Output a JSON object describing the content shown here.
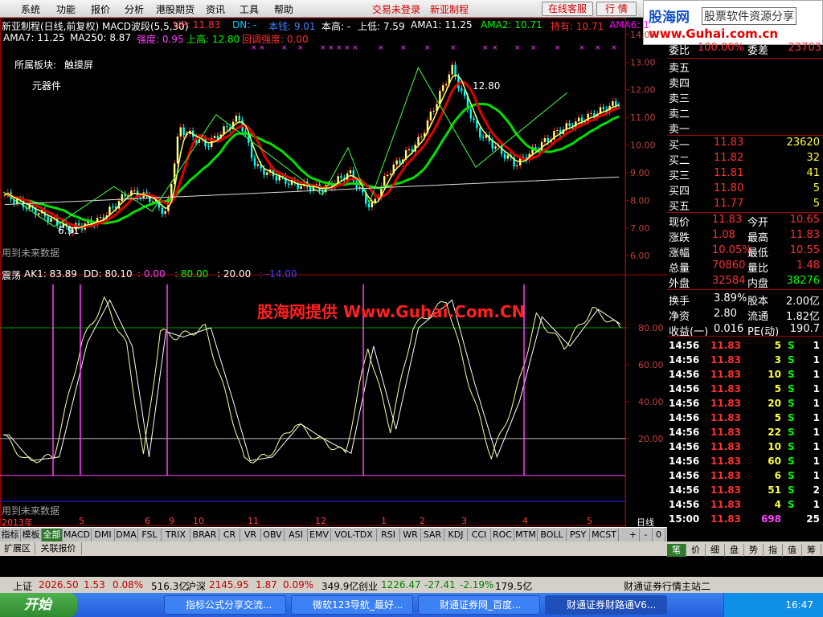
{
  "menu": {
    "items": [
      "系统",
      "功能",
      "报价",
      "分析",
      "港股期货",
      "资讯",
      "工具",
      "帮助"
    ],
    "trade_not_logged": "交易未登录",
    "stock_name": "新亚制程",
    "online_service": "在线客服",
    "market": "行 情"
  },
  "logo": {
    "l1": "股海网",
    "l2": "股票软件资源分享",
    "l3": "www.Guhai.com.cn"
  },
  "main_chart": {
    "title": "新亚制程(日线,前复权) MACD波段(5,5,30)",
    "ind1": [
      {
        "t": "UP: 11.83",
        "c": "#ff3030"
      },
      {
        "t": "DN: -",
        "c": "#00c8ff"
      },
      {
        "t": "本钱: 9.01",
        "c": "#4080ff"
      },
      {
        "t": "本高: -",
        "c": "#ffffff"
      },
      {
        "t": "上低: 7.59",
        "c": "#ffffff"
      },
      {
        "t": "AMA1: 11.25",
        "c": "#ffffff"
      },
      {
        "t": "AMA2: 10.71",
        "c": "#00ff00"
      },
      {
        "t": "持有: 10.71",
        "c": "#ff3030"
      },
      {
        "t": "AMA6: 1",
        "c": "#ff00ff"
      }
    ],
    "ind2": [
      {
        "t": "AMA7: 11.25",
        "c": "#ffffff"
      },
      {
        "t": "MA250: 8.87",
        "c": "#ffffff"
      },
      {
        "t": "强度: 0.95",
        "c": "#ff40ff"
      },
      {
        "t": "上高: 12.80",
        "c": "#00ff00"
      },
      {
        "t": "回调强度: 0.00",
        "c": "#ff3030"
      }
    ],
    "sector_label": "所属板块:",
    "sector1": "触摸屏",
    "sector2": "元器件",
    "peak_label": "12.80",
    "low_label": "6.91",
    "future1": "用到未来数据",
    "yticks": [
      "14.00",
      "13.00",
      "12.00",
      "11.00",
      "10.00",
      "9.00",
      "8.00",
      "7.00",
      "6.00"
    ]
  },
  "osc_chart": {
    "title": "震荡",
    "ind": [
      {
        "t": "AK1: 83.89",
        "c": "#ffffff"
      },
      {
        "t": "DD: 80.10",
        "c": "#ffffff"
      },
      {
        "t": ": 0.00",
        "c": "#ff40ff"
      },
      {
        "t": ": 80.00",
        "c": "#00ff00"
      },
      {
        "t": ": 20.00",
        "c": "#ffffff"
      },
      {
        "t": ": -14.00",
        "c": "#4040ff"
      }
    ],
    "yticks": [
      "80.00",
      "60.00",
      "40.00",
      "20.00"
    ],
    "future": "用到未来数据",
    "watermark": "股海网提供 Www.Guhai.Com.CN"
  },
  "xaxis": {
    "labels": [
      "2013年",
      "5",
      "6",
      "9",
      "10",
      "11",
      "12",
      "1",
      "2",
      "3",
      "4",
      "5"
    ],
    "period": "日线"
  },
  "indicator_tabs": [
    "指标",
    "模板",
    "全部",
    "MACD",
    "DMI",
    "DMA",
    "FSL",
    "TRIX",
    "BRAR",
    "CR",
    "VR",
    "OBV",
    "ASI",
    "EMV",
    "VOL-TDX",
    "RSI",
    "WR",
    "SAR",
    "KDJ",
    "CCI",
    "ROC",
    "MTM",
    "BOLL",
    "PSY",
    "MCST"
  ],
  "tab_controls": [
    "+",
    "-",
    "0"
  ],
  "sub_tabs": [
    "扩展区",
    "关联报价"
  ],
  "quote": {
    "wei": {
      "l1": "委比",
      "v1": "100.00%",
      "l2": "委差",
      "v2": "23703"
    },
    "sells": [
      "卖五",
      "卖四",
      "卖三",
      "卖二",
      "卖一"
    ],
    "buys": [
      {
        "n": "买一",
        "p": "11.83",
        "v": "23620"
      },
      {
        "n": "买二",
        "p": "11.82",
        "v": "32"
      },
      {
        "n": "买三",
        "p": "11.81",
        "v": "41"
      },
      {
        "n": "买四",
        "p": "11.80",
        "v": "5"
      },
      {
        "n": "买五",
        "p": "11.77",
        "v": "5"
      }
    ],
    "stats": [
      {
        "a": "现价",
        "av": "11.83",
        "b": "今开",
        "bv": "10.65"
      },
      {
        "a": "涨跌",
        "av": "1.08",
        "b": "最高",
        "bv": "11.83"
      },
      {
        "a": "涨幅",
        "av": "10.05%",
        "b": "最低",
        "bv": "10.55"
      },
      {
        "a": "总量",
        "av": "70860",
        "b": "量比",
        "bv": "1.48"
      },
      {
        "a": "外盘",
        "av": "32584",
        "b": "内盘",
        "bv": "38276"
      }
    ],
    "fund": [
      {
        "a": "换手",
        "av": "3.89%",
        "b": "股本",
        "bv": "2.00亿"
      },
      {
        "a": "净资",
        "av": "2.80",
        "b": "流通",
        "bv": "1.82亿"
      },
      {
        "a": "收益(一)",
        "av": "0.016",
        "b": "PE(动)",
        "bv": "190.7"
      }
    ]
  },
  "ticks": [
    {
      "t": "14:56",
      "p": "11.83",
      "v": "5",
      "s": "S",
      "n": "1"
    },
    {
      "t": "14:56",
      "p": "11.83",
      "v": "3",
      "s": "S",
      "n": "1"
    },
    {
      "t": "14:56",
      "p": "11.83",
      "v": "10",
      "s": "S",
      "n": "1"
    },
    {
      "t": "14:56",
      "p": "11.83",
      "v": "5",
      "s": "S",
      "n": "1"
    },
    {
      "t": "14:56",
      "p": "11.83",
      "v": "20",
      "s": "S",
      "n": "1"
    },
    {
      "t": "14:56",
      "p": "11.83",
      "v": "5",
      "s": "S",
      "n": "1"
    },
    {
      "t": "14:56",
      "p": "11.83",
      "v": "22",
      "s": "S",
      "n": "1"
    },
    {
      "t": "14:56",
      "p": "11.83",
      "v": "10",
      "s": "S",
      "n": "1"
    },
    {
      "t": "14:56",
      "p": "11.83",
      "v": "60",
      "s": "S",
      "n": "1"
    },
    {
      "t": "14:56",
      "p": "11.83",
      "v": "6",
      "s": "S",
      "n": "1"
    },
    {
      "t": "14:56",
      "p": "11.83",
      "v": "51",
      "s": "S",
      "n": "2"
    },
    {
      "t": "14:56",
      "p": "11.83",
      "v": "4",
      "s": "S",
      "n": "1"
    },
    {
      "t": "15:00",
      "p": "11.83",
      "v": "698",
      "s": "",
      "n": "25"
    }
  ],
  "right_tabs": [
    "笔",
    "价",
    "细",
    "盘",
    "势",
    "指",
    "值",
    "筹"
  ],
  "status": [
    {
      "t": "上证",
      "c": "#000000"
    },
    {
      "t": "2026.50",
      "c": "#c00000"
    },
    {
      "t": "1.53",
      "c": "#c00000"
    },
    {
      "t": "0.08%",
      "c": "#c00000"
    },
    {
      "t": "516.3亿",
      "c": "#000000"
    },
    {
      "t": "沪深",
      "c": "#000000"
    },
    {
      "t": "2145.95",
      "c": "#c00000"
    },
    {
      "t": "1.87",
      "c": "#c00000"
    },
    {
      "t": "0.09%",
      "c": "#c00000"
    },
    {
      "t": "349.9亿",
      "c": "#000000"
    },
    {
      "t": "创业",
      "c": "#000000"
    },
    {
      "t": "1226.47",
      "c": "#008000"
    },
    {
      "t": "-27.41",
      "c": "#008000"
    },
    {
      "t": "-2.19%",
      "c": "#008000"
    },
    {
      "t": "179.5亿",
      "c": "#000000"
    },
    {
      "t": "财通证券行情主站二",
      "c": "#000000"
    }
  ],
  "taskbar": {
    "start": "开始",
    "tasks": [
      "指标公式分享交流...",
      "微软123导航_最好...",
      "财通证券网_百度...",
      "财通证券财路通V6..."
    ],
    "clock": "16:47"
  }
}
